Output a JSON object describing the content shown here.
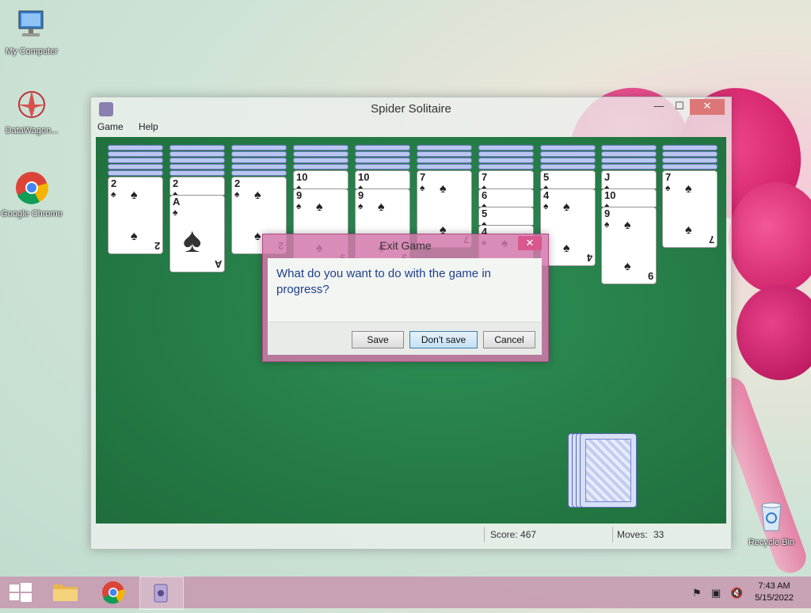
{
  "desktop": {
    "icons": [
      {
        "label": "My Computer"
      },
      {
        "label": "DataWagon..."
      },
      {
        "label": "Google Chrome"
      },
      {
        "label": "Recycle Bin"
      }
    ]
  },
  "window": {
    "title": "Spider Solitaire",
    "minimize": "—",
    "maximize": "☐",
    "close": "✕",
    "menu": [
      "Game",
      "Help"
    ]
  },
  "tableau": [
    {
      "backs": 5,
      "cards": [
        {
          "rank": "2",
          "suit": "♠"
        }
      ]
    },
    {
      "backs": 5,
      "cards": [
        {
          "rank": "2",
          "suit": "♠"
        },
        {
          "rank": "A",
          "suit": "♠"
        }
      ]
    },
    {
      "backs": 5,
      "cards": [
        {
          "rank": "2",
          "suit": "♠"
        }
      ]
    },
    {
      "backs": 4,
      "cards": [
        {
          "rank": "10",
          "suit": "♠"
        },
        {
          "rank": "9",
          "suit": "♠"
        }
      ]
    },
    {
      "backs": 4,
      "cards": [
        {
          "rank": "10",
          "suit": "♠"
        },
        {
          "rank": "9",
          "suit": "♠"
        }
      ]
    },
    {
      "backs": 4,
      "cards": [
        {
          "rank": "7",
          "suit": "♠"
        }
      ]
    },
    {
      "backs": 4,
      "cards": [
        {
          "rank": "7",
          "suit": "♠"
        },
        {
          "rank": "6",
          "suit": "♠"
        },
        {
          "rank": "5",
          "suit": "♠"
        },
        {
          "rank": "4",
          "suit": "♠"
        }
      ]
    },
    {
      "backs": 4,
      "cards": [
        {
          "rank": "5",
          "suit": "♠"
        },
        {
          "rank": "4",
          "suit": "♠"
        }
      ]
    },
    {
      "backs": 4,
      "cards": [
        {
          "rank": "J",
          "suit": "♠"
        },
        {
          "rank": "10",
          "suit": "♠"
        },
        {
          "rank": "9",
          "suit": "♠"
        }
      ]
    },
    {
      "backs": 4,
      "cards": [
        {
          "rank": "7",
          "suit": "♠"
        }
      ]
    }
  ],
  "stock": {
    "piles": 4
  },
  "status": {
    "score_label": "Score: 467",
    "moves_label": "Moves:",
    "moves_value": "33"
  },
  "dialog": {
    "title": "Exit Game",
    "message": "What do you want to do with the game in progress?",
    "buttons": {
      "save": "Save",
      "dont_save": "Don't save",
      "cancel": "Cancel"
    }
  },
  "taskbar": {
    "time": "7:43 AM",
    "date": "5/15/2022"
  }
}
